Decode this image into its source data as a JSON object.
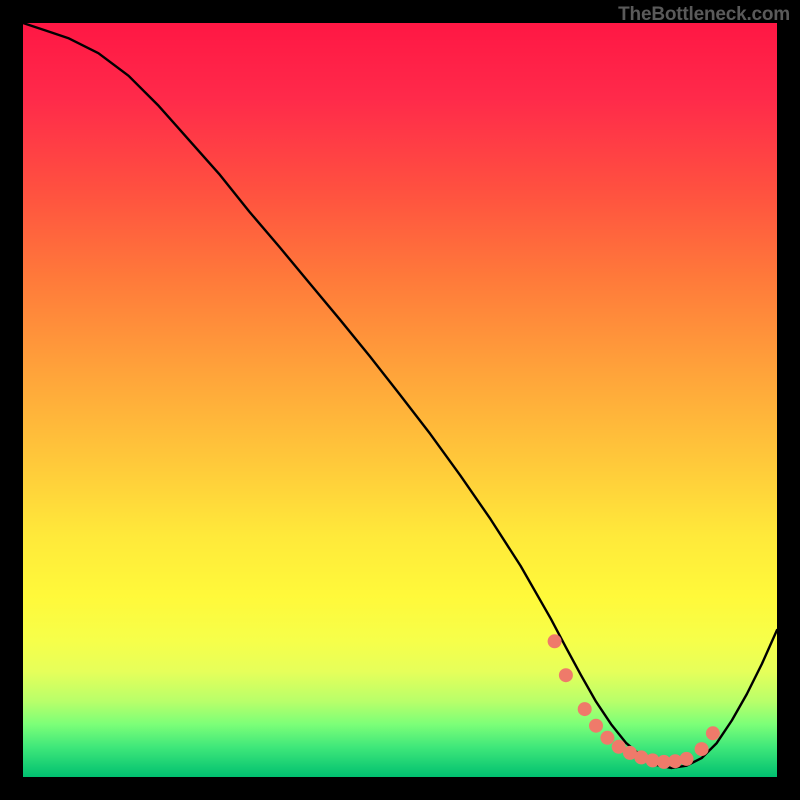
{
  "watermark": "TheBottleneck.com",
  "chart_data": {
    "type": "line",
    "title": "",
    "xlabel": "",
    "ylabel": "",
    "ylim": [
      0,
      100
    ],
    "xlim": [
      0,
      100
    ],
    "series": [
      {
        "name": "bottleneck-curve",
        "x": [
          0,
          3,
          6,
          10,
          14,
          18,
          22,
          26,
          30,
          34,
          38,
          42,
          46,
          50,
          54,
          58,
          62,
          66,
          70,
          72,
          74,
          76,
          78,
          80,
          82,
          84,
          86,
          88,
          90,
          92,
          94,
          96,
          98,
          100
        ],
        "y": [
          100,
          99,
          98,
          96,
          93,
          89,
          84.5,
          80,
          75,
          70.3,
          65.5,
          60.7,
          55.8,
          50.7,
          45.5,
          40,
          34.2,
          28,
          21,
          17.2,
          13.5,
          10,
          7,
          4.5,
          2.8,
          1.6,
          1.2,
          1.5,
          2.5,
          4.5,
          7.5,
          11,
          15,
          19.5
        ]
      }
    ],
    "markers": {
      "name": "recommended-range-dots",
      "x": [
        70.5,
        72,
        74.5,
        76,
        77.5,
        79,
        80.5,
        82,
        83.5,
        85,
        86.5,
        88,
        90,
        91.5
      ],
      "y": [
        18,
        13.5,
        9,
        6.8,
        5.2,
        4,
        3.2,
        2.6,
        2.2,
        2,
        2.1,
        2.4,
        3.7,
        5.8
      ]
    },
    "background_gradient": {
      "top_color": "#ff1744",
      "mid_color": "#ffe93a",
      "bottom_color": "#00c070",
      "orientation": "vertical"
    }
  }
}
